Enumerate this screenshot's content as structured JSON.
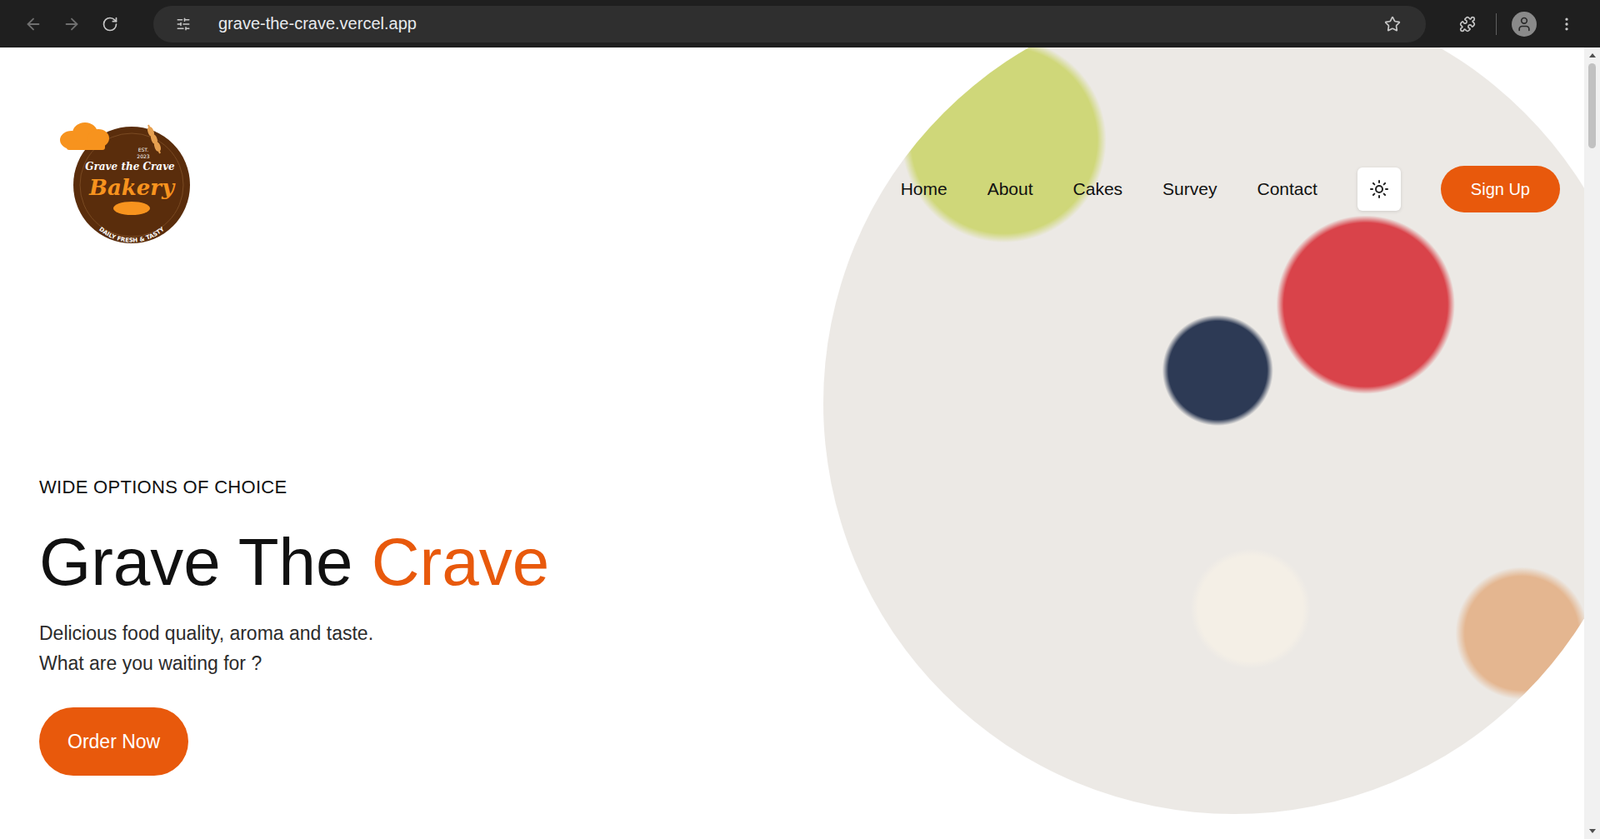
{
  "browser": {
    "url": "grave-the-crave.vercel.app"
  },
  "logo": {
    "est": "EST.",
    "year": "2023",
    "name": "Grave the Crave",
    "word": "Bakery",
    "tagline": "DAILY FRESH & TASTY"
  },
  "nav": {
    "items": [
      {
        "label": "Home"
      },
      {
        "label": "About"
      },
      {
        "label": "Cakes"
      },
      {
        "label": "Survey"
      },
      {
        "label": "Contact"
      }
    ],
    "signup": "Sign Up"
  },
  "hero": {
    "eyebrow": "WIDE OPTIONS OF CHOICE",
    "title": "Grave The",
    "title_accent": "Crave",
    "lines": [
      "Delicious food quality, aroma and taste.",
      "What are you waiting for ?"
    ],
    "button": "Order Now"
  }
}
